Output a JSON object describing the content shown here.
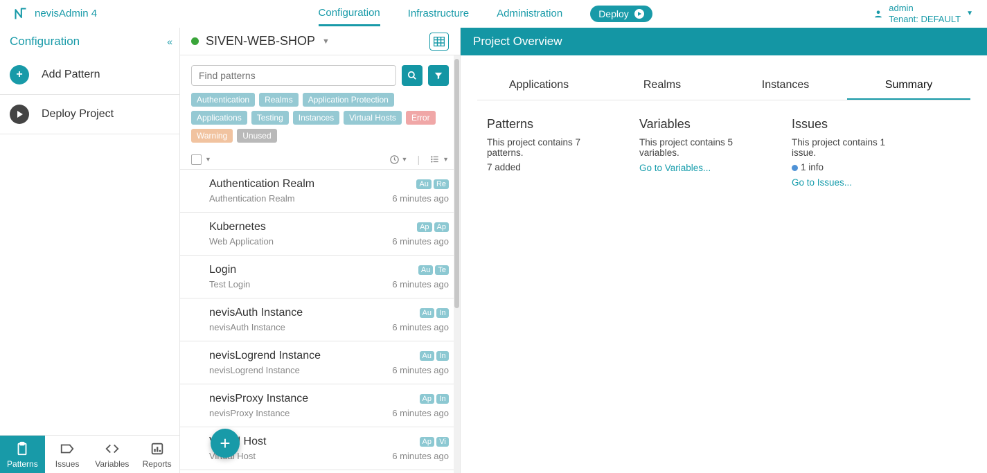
{
  "brand": "nevisAdmin 4",
  "topnav": {
    "configuration": "Configuration",
    "infrastructure": "Infrastructure",
    "administration": "Administration"
  },
  "deploy_label": "Deploy",
  "user": {
    "name": "admin",
    "tenant": "Tenant: DEFAULT"
  },
  "left": {
    "title": "Configuration",
    "add_pattern": "Add Pattern",
    "deploy_project": "Deploy Project",
    "tabs": {
      "patterns": "Patterns",
      "issues": "Issues",
      "variables": "Variables",
      "reports": "Reports"
    }
  },
  "mid": {
    "project_name": "SIVEN-WEB-SHOP",
    "search_placeholder": "Find patterns",
    "chips": [
      "Authentication",
      "Realms",
      "Application Protection",
      "Applications",
      "Testing",
      "Instances",
      "Virtual Hosts",
      "Error",
      "Warning",
      "Unused"
    ],
    "chip_styles": [
      "",
      "",
      "",
      "",
      "",
      "",
      "",
      "err",
      "warn",
      "grey"
    ],
    "patterns": [
      {
        "name": "Authentication Realm",
        "sub": "Authentication Realm",
        "time": "6 minutes ago",
        "tags": [
          "Au",
          "Re"
        ]
      },
      {
        "name": "Kubernetes",
        "sub": "Web Application",
        "time": "6 minutes ago",
        "tags": [
          "Ap",
          "Ap"
        ]
      },
      {
        "name": "Login",
        "sub": "Test Login",
        "time": "6 minutes ago",
        "tags": [
          "Au",
          "Te"
        ]
      },
      {
        "name": "nevisAuth Instance",
        "sub": "nevisAuth Instance",
        "time": "6 minutes ago",
        "tags": [
          "Au",
          "In"
        ]
      },
      {
        "name": "nevisLogrend Instance",
        "sub": "nevisLogrend Instance",
        "time": "6 minutes ago",
        "tags": [
          "Au",
          "In"
        ]
      },
      {
        "name": "nevisProxy Instance",
        "sub": "nevisProxy Instance",
        "time": "6 minutes ago",
        "tags": [
          "Ap",
          "In"
        ]
      },
      {
        "name": "Virtual Host",
        "sub": "Virtual Host",
        "time": "6 minutes ago",
        "tags": [
          "Ap",
          "Vi"
        ]
      }
    ]
  },
  "right": {
    "header": "Project Overview",
    "tabs": {
      "applications": "Applications",
      "realms": "Realms",
      "instances": "Instances",
      "summary": "Summary"
    },
    "patterns": {
      "title": "Patterns",
      "body": "This project contains 7 patterns.",
      "sub": "7 added"
    },
    "variables": {
      "title": "Variables",
      "body": "This project contains 5 variables.",
      "link": "Go to Variables..."
    },
    "issues": {
      "title": "Issues",
      "body": "This project contains 1 issue.",
      "info": "1 info",
      "link": "Go to Issues..."
    }
  }
}
